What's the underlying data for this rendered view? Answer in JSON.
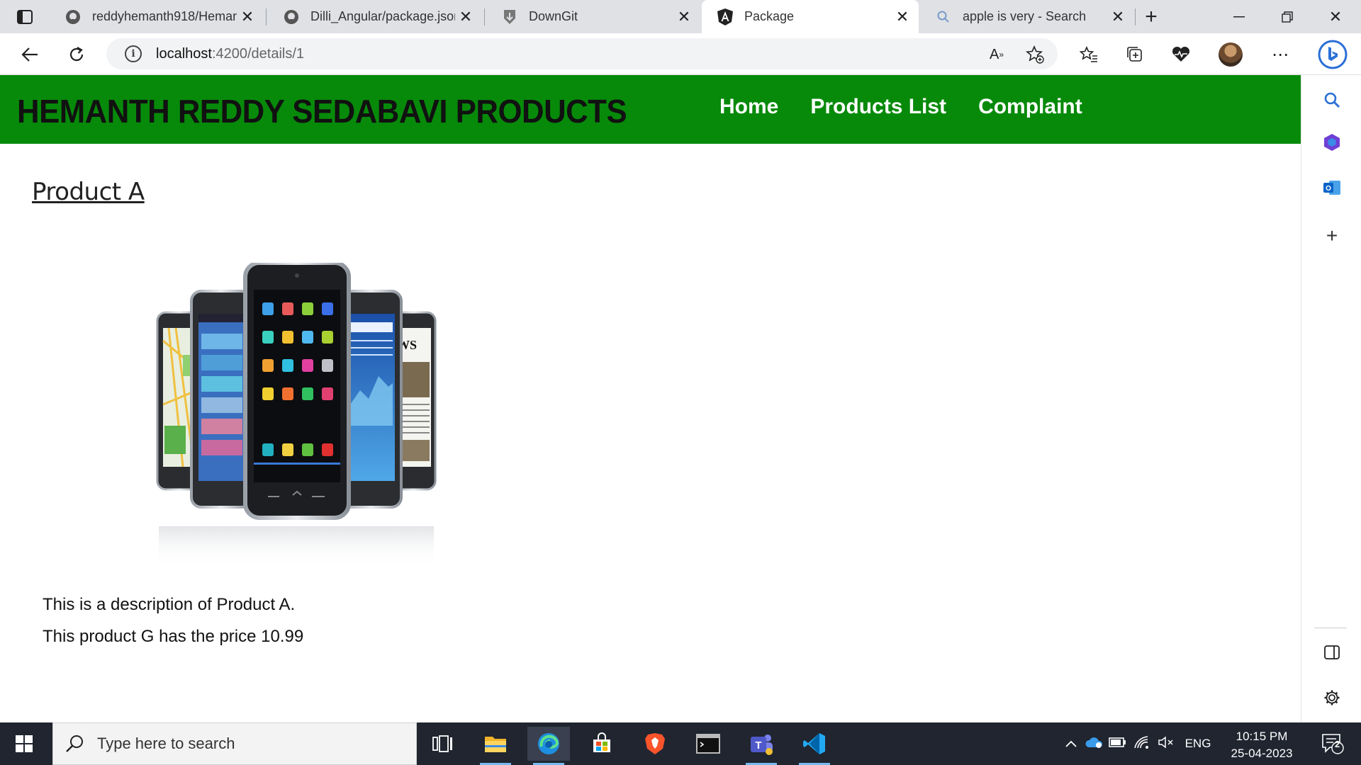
{
  "browser": {
    "tabs": [
      {
        "title": "reddyhemanth918/Heman",
        "icon": "github-icon"
      },
      {
        "title": "Dilli_Angular/package.json",
        "icon": "github-icon"
      },
      {
        "title": "DownGit",
        "icon": "downgit-icon"
      },
      {
        "title": "Package",
        "icon": "angular-icon",
        "active": true
      },
      {
        "title": "apple is very - Search",
        "icon": "search-icon"
      }
    ],
    "url_host": "localhost",
    "url_path": ":4200/details/1"
  },
  "app": {
    "brand": "HEMANTH REDDY SEDABAVI PRODUCTS",
    "nav": {
      "home": "Home",
      "products": "Products List",
      "complaint": "Complaint"
    },
    "brand_color": "#078a0a"
  },
  "product": {
    "name": "Product A",
    "description": "This is a description of Product A.",
    "price_line": "This product G has the price 10.99",
    "image": "smartphones-image"
  },
  "taskbar": {
    "search_placeholder": "Type here to search",
    "language": "ENG",
    "time": "10:15 PM",
    "date": "25-04-2023",
    "notification_count": "2"
  }
}
